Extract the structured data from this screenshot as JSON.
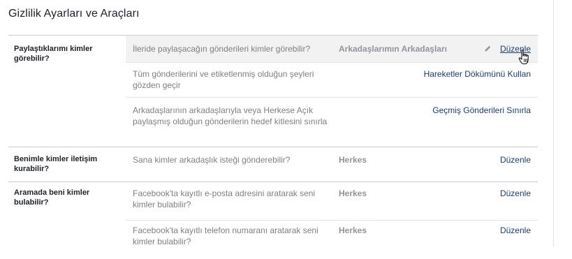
{
  "page": {
    "title": "Gizlilik Ayarları ve Araçları"
  },
  "sections": [
    {
      "label": "Paylaştıklarımı kimler görebilir?",
      "rows": [
        {
          "question": "İleride paylaşacağın gönderileri kimler görebilir?",
          "value": "Arkadaşlarımın Arkadaşları",
          "action": "Düzenle",
          "icon": "pencil-icon"
        },
        {
          "question": "Tüm gönderilerini ve etiketlenmiş olduğun şeyleri gözden geçir",
          "value": "",
          "action": "Hareketler Dökümünü Kullan"
        },
        {
          "question": "Arkadaşlarının arkadaşlarıyla veya Herkese Açık paylaşmış olduğun gönderilerin hedef kitlesini sınırla",
          "value": "",
          "action": "Geçmiş Gönderileri Sınırla"
        }
      ]
    },
    {
      "label": "Benimle kimler iletişim kurabilir?",
      "rows": [
        {
          "question": "Sana kimler arkadaşlık isteği gönderebilir?",
          "value": "Herkes",
          "action": "Düzenle"
        }
      ]
    },
    {
      "label": "Aramada beni kimler bulabilir?",
      "rows": [
        {
          "question": "Facebook'ta kayıtlı e-posta adresini aratarak seni kimler bulabilir?",
          "value": "Herkes",
          "action": "Düzenle"
        },
        {
          "question": "Facebook'ta kayıtlı telefon numaranı aratarak seni kimler bulabilir?",
          "value": "Herkes",
          "action": "Düzenle"
        }
      ]
    }
  ],
  "colors": {
    "link": "#1d3b6b",
    "muted_text": "#7f7f7f",
    "value_text": "#90949c",
    "divider": "#c9ccd1",
    "highlight_row": "#f2f2f2"
  },
  "cursor": {
    "icon": "hand-pointer-icon"
  }
}
